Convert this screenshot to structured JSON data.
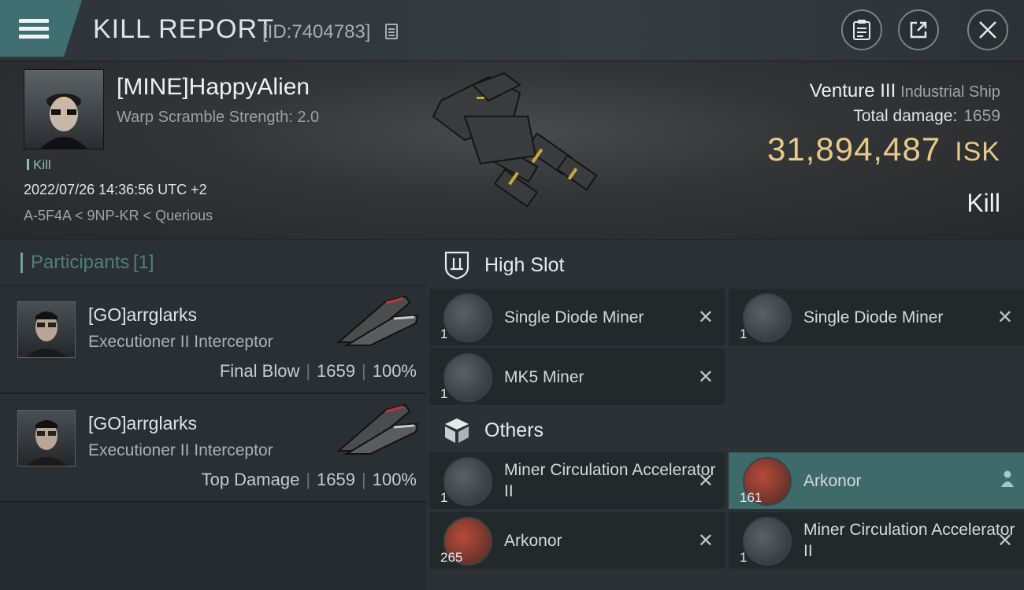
{
  "header": {
    "title": "KILL REPORT",
    "report_id": "[ID:7404783]",
    "icons": {
      "menu": "hamburger-menu-icon",
      "copy": "copy-icon",
      "report": "clipboard-icon",
      "share": "share-icon",
      "close": "close-icon"
    }
  },
  "victim": {
    "name": "[MINE]HappyAlien",
    "warp_scramble": "Warp Scramble Strength: 2.0",
    "result_small": "Kill",
    "datetime": "2022/07/26 14:36:56 UTC +2",
    "location": "A-5F4A < 9NP-KR < Querious",
    "ship_name": "Venture III",
    "ship_type": "Industrial Ship",
    "total_damage_label": "Total damage:",
    "total_damage_value": "1659",
    "isk_value": "31,894,487",
    "isk_unit": "ISK",
    "result_big": "Kill"
  },
  "participants": {
    "label": "Participants",
    "count": "[1]",
    "rows": [
      {
        "name": "[GO]arrglarks",
        "ship": "Executioner II Interceptor",
        "role": "Final Blow",
        "damage": "1659",
        "percent": "100%"
      },
      {
        "name": "[GO]arrglarks",
        "ship": "Executioner II Interceptor",
        "role": "Top Damage",
        "damage": "1659",
        "percent": "100%"
      }
    ]
  },
  "high_slot": {
    "label": "High Slot",
    "items": [
      {
        "name": "Single Diode Miner",
        "qty": "1",
        "action": "✕"
      },
      {
        "name": "Single Diode Miner",
        "qty": "1",
        "action": "✕"
      },
      {
        "name": "MK5 Miner",
        "qty": "1",
        "action": "✕"
      }
    ]
  },
  "others": {
    "label": "Others",
    "items": [
      {
        "name": "Miner Circulation Accelerator II",
        "qty": "1",
        "action": "✕"
      },
      {
        "name": "Arkonor",
        "qty": "161",
        "action": "person-icon"
      },
      {
        "name": "Arkonor",
        "qty": "265",
        "action": "✕"
      },
      {
        "name": "Miner Circulation Accelerator II",
        "qty": "1",
        "action": "✕"
      }
    ]
  },
  "colors": {
    "accent": "#3f6f70",
    "isk": "#e9c98a",
    "highlight_row": "#3e6a6a"
  }
}
